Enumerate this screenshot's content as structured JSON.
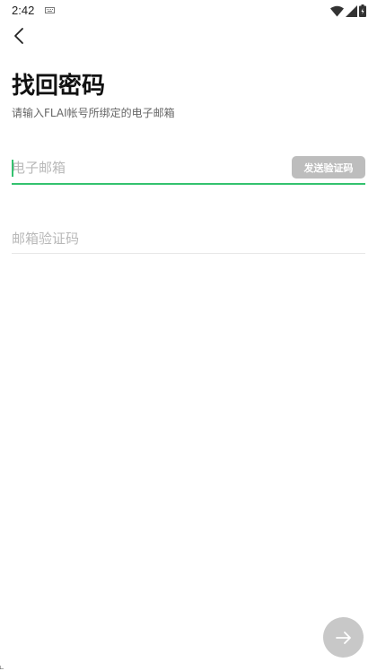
{
  "status_bar": {
    "time": "2:42",
    "icons": [
      "keyboard-icon",
      "wifi-icon",
      "signal-icon",
      "battery-icon"
    ]
  },
  "nav": {
    "back_icon": "chevron-left-icon"
  },
  "header": {
    "title": "找回密码",
    "subtitle": "请输入FLAI帐号所绑定的电子邮箱"
  },
  "form": {
    "email": {
      "value": "",
      "placeholder": "电子邮箱"
    },
    "send_code_label": "发送验证码",
    "code": {
      "value": "",
      "placeholder": "邮箱验证码"
    }
  },
  "next_button": {
    "icon": "arrow-right-icon"
  },
  "colors": {
    "accent": "#34c26f",
    "button_disabled": "#bdbdbd",
    "next_button_disabled": "#c8c8c8",
    "placeholder": "#b8b8b8",
    "subtitle": "#666666"
  }
}
